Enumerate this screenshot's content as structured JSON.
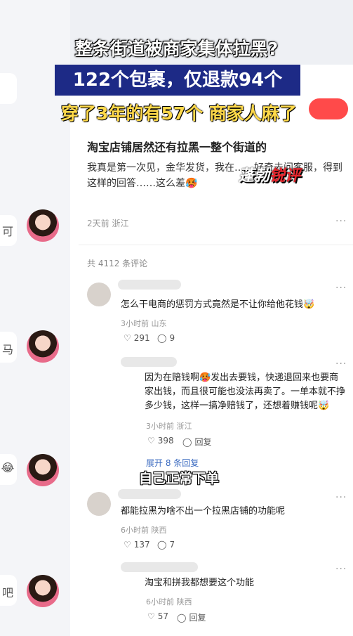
{
  "overlay": {
    "line1": "整条街道被商家集体拉黑?",
    "line2": "122个包裹，仅退款94个",
    "line3": "穿了3年的有57个 商家人麻了",
    "caption": "自己正常下单",
    "logo_part1": "蓬勃",
    "logo_part2": "锐评"
  },
  "left_strip": {
    "chars": [
      "可",
      "马",
      "😂",
      "吧"
    ]
  },
  "post": {
    "title": "淘宝店铺居然还有拉黑一整个街道的",
    "body": "我真是第一次见，金华发货，我在……好奇去问客服，得到这样的回答……这么差🥵",
    "meta": "2天前 浙江",
    "more": "···"
  },
  "comments_header": "共 4112 条评论",
  "comments": [
    {
      "text": "怎么干电商的惩罚方式竟然是不让你给他花钱🤯",
      "meta": "3小时前 山东",
      "likes": "291",
      "replies": "9",
      "more": "···"
    },
    {
      "text": "因为在赔钱啊🥵发出去要钱，快递退回来也要商家出钱，而且很可能也没法再卖了。一单本就不挣多少钱，这样一搞净赔钱了，还想着赚钱呢🤯",
      "meta": "3小时前 浙江",
      "likes": "398",
      "replies": "回复",
      "expand": "展开 8 条回复",
      "more": "···"
    },
    {
      "text": "都能拉黑为啥不出一个拉黑店铺的功能呢",
      "meta": "6小时前 陕西",
      "likes": "137",
      "replies": "7",
      "more": "···"
    },
    {
      "text": "淘宝和拼我都想要这个功能",
      "meta": "6小时前 陕西",
      "likes": "57",
      "replies": "回复",
      "more": "···"
    }
  ],
  "colors": {
    "headline_bg": "#1d2a86",
    "headline_yellow": "#ffd94a",
    "link_blue": "#3a6ac0",
    "logo_red": "#e8262d"
  }
}
